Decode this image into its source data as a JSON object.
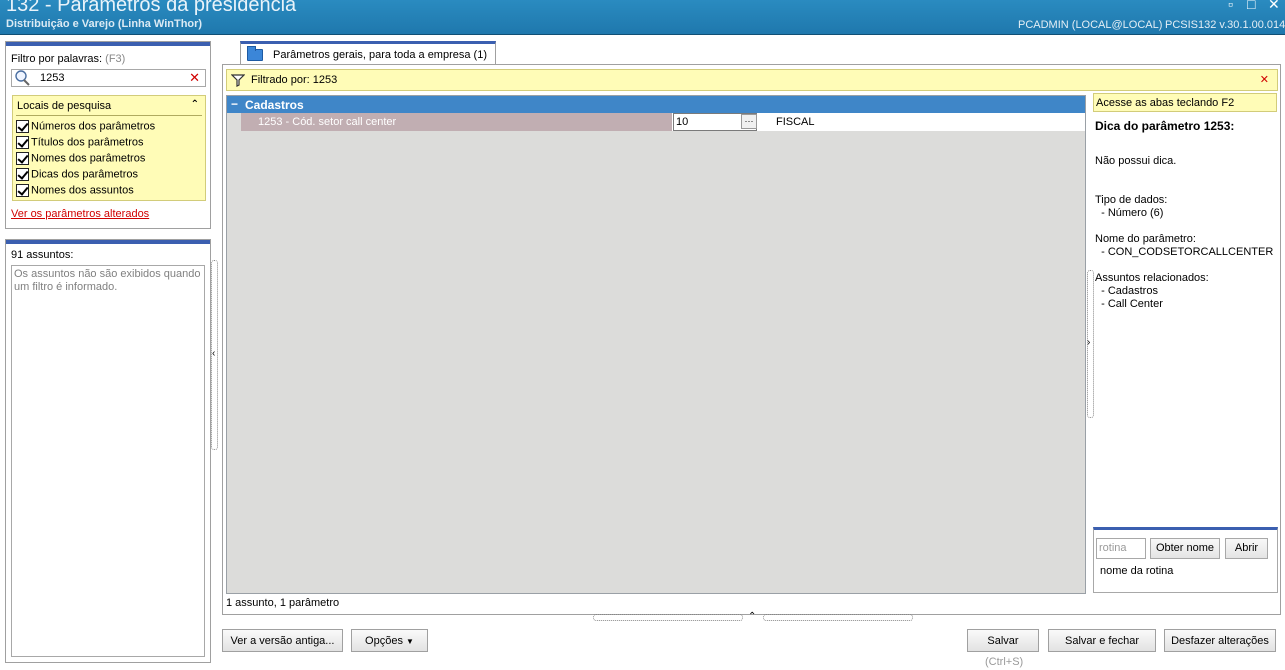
{
  "window": {
    "title": "132 - Parâmetros da presidência",
    "subtitle": "Distribuição e Varejo (Linha WinThor)",
    "user": "PCADMIN (LOCAL@LOCAL)",
    "version": "PCSIS132  v.30.1.00.014"
  },
  "filter_panel": {
    "label": "Filtro por palavras:",
    "shortcut": "(F3)",
    "search_value": "1253",
    "locais_title": "Locais de pesquisa",
    "checkboxes": [
      {
        "label": "Números dos parâmetros",
        "checked": true
      },
      {
        "label": "Títulos dos parâmetros",
        "checked": true
      },
      {
        "label": "Nomes dos parâmetros",
        "checked": true
      },
      {
        "label": "Dicas dos parâmetros",
        "checked": true
      },
      {
        "label": "Nomes dos assuntos",
        "checked": true
      }
    ],
    "changed_link": "Ver os parâmetros alterados"
  },
  "subjects_panel": {
    "label": "91 assuntos:",
    "message": "Os assuntos não são exibidos quando um filtro é informado."
  },
  "tab": {
    "label": "Parâmetros gerais, para toda a empresa  (1)"
  },
  "filterbar": {
    "text": "Filtrado por: 1253"
  },
  "grid": {
    "group": "Cadastros",
    "rows": [
      {
        "name": "1253 - Cód. setor call center",
        "value": "10",
        "module": "FISCAL"
      }
    ],
    "footer": "1 assunto, 1 parâmetro"
  },
  "help": {
    "hint": "Acesse as abas teclando F2",
    "title": "Dica do parâmetro 1253:",
    "tip": "Não possui dica.",
    "type_label": "Tipo de dados:",
    "type_value": "  - Número (6)",
    "name_label": "Nome do parâmetro:",
    "name_value": "  - CON_CODSETORCALLCENTER",
    "subjects_label": "Assuntos relacionados:",
    "subjects": [
      "  - Cadastros",
      "  - Call Center"
    ]
  },
  "rotina": {
    "placeholder": "rotina",
    "get_name_button": "Obter nome",
    "open_button": "Abrir",
    "name_label": "nome da rotina"
  },
  "buttons": {
    "old_version": "Ver a versão antiga...",
    "options": "Opções",
    "save": "Salvar",
    "save_shortcut": "(Ctrl+S)",
    "save_close": "Salvar e fechar",
    "undo": "Desfazer alterações"
  }
}
